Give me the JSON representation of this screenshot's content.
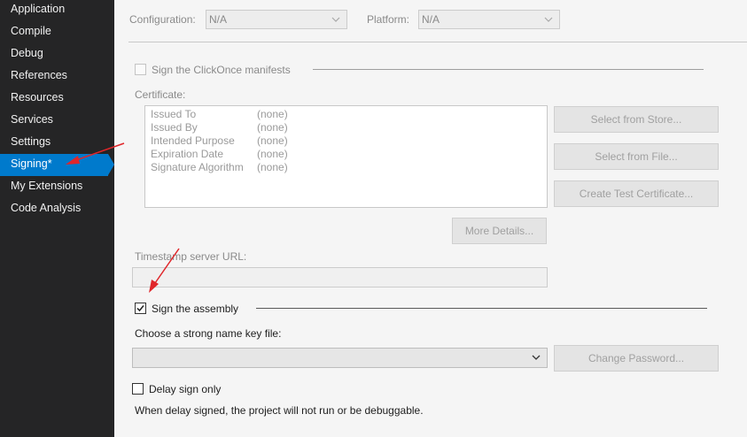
{
  "sidebar": {
    "items": [
      {
        "label": "Application"
      },
      {
        "label": "Compile"
      },
      {
        "label": "Debug"
      },
      {
        "label": "References"
      },
      {
        "label": "Resources"
      },
      {
        "label": "Services"
      },
      {
        "label": "Settings"
      },
      {
        "label": "Signing*"
      },
      {
        "label": "My Extensions"
      },
      {
        "label": "Code Analysis"
      }
    ],
    "active_index": 7,
    "active_color": "#007acc"
  },
  "toolbar": {
    "configuration_label": "Configuration:",
    "configuration_value": "N/A",
    "platform_label": "Platform:",
    "platform_value": "N/A"
  },
  "clickonce": {
    "checkbox_label": "Sign the ClickOnce manifests",
    "checked": false,
    "certificate_label": "Certificate:",
    "certificate_fields": [
      {
        "key": "Issued To",
        "value": "(none)"
      },
      {
        "key": "Issued By",
        "value": "(none)"
      },
      {
        "key": "Intended Purpose",
        "value": "(none)"
      },
      {
        "key": "Expiration Date",
        "value": "(none)"
      },
      {
        "key": "Signature Algorithm",
        "value": "(none)"
      }
    ],
    "select_from_store": "Select from Store...",
    "select_from_file": "Select from File...",
    "create_test_certificate": "Create Test Certificate...",
    "more_details": "More Details...",
    "timestamp_label": "Timestamp server URL:",
    "timestamp_value": ""
  },
  "assembly": {
    "checkbox_label": "Sign the assembly",
    "checked": true,
    "key_file_label": "Choose a strong name key file:",
    "key_file_value": "",
    "change_password": "Change Password...",
    "delay_sign_label": "Delay sign only",
    "delay_sign_checked": false,
    "delay_note": "When delay signed, the project will not run or be debuggable."
  },
  "annotation_color": "#e0262a"
}
